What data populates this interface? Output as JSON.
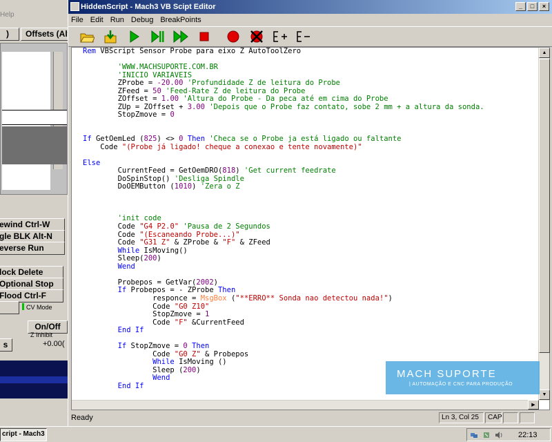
{
  "background_app": {
    "menu_fragment": "Help",
    "offsets_tab": "Offsets (Alt",
    "left_tab": ")",
    "rewind": "ewind Ctrl-W",
    "single_block": "gle BLK Alt-N",
    "reverse_run": "everse Run",
    "block_delete": "lock Delete",
    "optional_stop": "Optional Stop",
    "flood": "Flood Ctrl-F",
    "cv_mode": "CV Mode",
    "on_off": "On/Off",
    "z_inhibit": "Z Inhibit",
    "s_fragment": "s",
    "value": "+0.00("
  },
  "editor": {
    "title": "HiddenScript - Mach3 VB Scipt Editor",
    "menu": [
      "File",
      "Edit",
      "Run",
      "Debug",
      "BreakPoints"
    ],
    "toolbar_icons": [
      "open-folder-icon",
      "save-icon",
      "run-icon",
      "pause-icon",
      "step-icon",
      "stop-icon",
      "breakpoint-icon",
      "clear-breakpoint-icon",
      "watch-add-icon",
      "watch-remove-icon"
    ],
    "status": {
      "text": "Ready",
      "position": "Ln 3, Col 25",
      "caps": "CAP"
    },
    "watermark": {
      "title": "MACH SUPORTE",
      "subtitle": "| AUTOMAÇÃO E CNC PARA PRODUÇÃO"
    },
    "code_lines": [
      [
        [
          "k",
          "Rem"
        ],
        [
          "p",
          " VBScript Sensor Probe para eixo Z AutoToolZero"
        ]
      ],
      [
        [
          "p",
          ""
        ]
      ],
      [
        [
          "c",
          "        'WWW.MACHSUPORTE.COM.BR"
        ]
      ],
      [
        [
          "c",
          "        'INICIO VARIAVEIS"
        ]
      ],
      [
        [
          "p",
          "        ZProbe = "
        ],
        [
          "n",
          "-20.00"
        ],
        [
          "c",
          " 'Profundidade Z de leitura do Probe"
        ]
      ],
      [
        [
          "p",
          "        ZFeed = "
        ],
        [
          "n",
          "50"
        ],
        [
          "c",
          " 'Feed-Rate Z de leitura do Probe"
        ]
      ],
      [
        [
          "p",
          "        ZOffset = "
        ],
        [
          "n",
          "1.00"
        ],
        [
          "c",
          " 'Altura do Probe - Da peca até em cima do Probe"
        ]
      ],
      [
        [
          "p",
          "        ZUp = ZOffset + "
        ],
        [
          "n",
          "3.00"
        ],
        [
          "c",
          " 'Depois que o Probe faz contato, sobe 2 mm + a altura da sonda."
        ]
      ],
      [
        [
          "p",
          "        StopZmove = "
        ],
        [
          "n",
          "0"
        ]
      ],
      [
        [
          "p",
          ""
        ]
      ],
      [
        [
          "p",
          ""
        ]
      ],
      [
        [
          "k",
          "If"
        ],
        [
          "p",
          " GetOemLed ("
        ],
        [
          "n",
          "825"
        ],
        [
          "p",
          ") <> "
        ],
        [
          "n",
          "0"
        ],
        [
          "k",
          " Then"
        ],
        [
          "c",
          " 'Checa se o Probe ja está ligado ou faltante"
        ]
      ],
      [
        [
          "p",
          "    Code "
        ],
        [
          "s",
          "\"(Probe já ligado! cheque a conexao e tente novamente)\""
        ]
      ],
      [
        [
          "p",
          ""
        ]
      ],
      [
        [
          "k",
          "Else"
        ]
      ],
      [
        [
          "p",
          "        CurrentFeed = GetOemDRO("
        ],
        [
          "n",
          "818"
        ],
        [
          "p",
          ") "
        ],
        [
          "c",
          "'Get current feedrate"
        ]
      ],
      [
        [
          "p",
          "        DoSpinStop() "
        ],
        [
          "c",
          "'Desliga Spindle"
        ]
      ],
      [
        [
          "p",
          "        DoOEMButton ("
        ],
        [
          "n",
          "1010"
        ],
        [
          "p",
          ") "
        ],
        [
          "c",
          "'Zera o Z"
        ]
      ],
      [
        [
          "p",
          ""
        ]
      ],
      [
        [
          "p",
          ""
        ]
      ],
      [
        [
          "p",
          ""
        ]
      ],
      [
        [
          "c",
          "        'init code"
        ]
      ],
      [
        [
          "p",
          "        Code "
        ],
        [
          "s",
          "\"G4 P2.0\""
        ],
        [
          "c",
          " 'Pausa de 2 Segundos"
        ]
      ],
      [
        [
          "p",
          "        Code "
        ],
        [
          "s",
          "\"(Escaneando Probe...)\""
        ]
      ],
      [
        [
          "p",
          "        Code "
        ],
        [
          "s",
          "\"G31 Z\""
        ],
        [
          "p",
          " & ZProbe & "
        ],
        [
          "s",
          "\"F\""
        ],
        [
          "p",
          " & ZFeed"
        ]
      ],
      [
        [
          "k",
          "        While"
        ],
        [
          "p",
          " IsMoving()"
        ]
      ],
      [
        [
          "p",
          "        Sleep("
        ],
        [
          "n",
          "200"
        ],
        [
          "p",
          ")"
        ]
      ],
      [
        [
          "k",
          "        Wend"
        ]
      ],
      [
        [
          "p",
          ""
        ]
      ],
      [
        [
          "p",
          "        Probepos = GetVar("
        ],
        [
          "n",
          "2002"
        ],
        [
          "p",
          ")"
        ]
      ],
      [
        [
          "k",
          "        If"
        ],
        [
          "p",
          " Probepos = - ZProbe "
        ],
        [
          "k",
          "Then"
        ]
      ],
      [
        [
          "p",
          "                responce = "
        ],
        [
          "m",
          "MsgBox"
        ],
        [
          "p",
          " ("
        ],
        [
          "s",
          "\"**ERRO** Sonda nao detectou nada!\""
        ],
        [
          "p",
          ")"
        ]
      ],
      [
        [
          "p",
          "                Code "
        ],
        [
          "s",
          "\"G0 Z10\""
        ]
      ],
      [
        [
          "p",
          "                StopZmove = "
        ],
        [
          "n",
          "1"
        ]
      ],
      [
        [
          "p",
          "                Code "
        ],
        [
          "s",
          "\"F\""
        ],
        [
          "p",
          " &CurrentFeed"
        ]
      ],
      [
        [
          "k",
          "        End If"
        ]
      ],
      [
        [
          "p",
          ""
        ]
      ],
      [
        [
          "k",
          "        If"
        ],
        [
          "p",
          " StopZmove = "
        ],
        [
          "n",
          "0"
        ],
        [
          "k",
          " Then"
        ]
      ],
      [
        [
          "p",
          "                Code "
        ],
        [
          "s",
          "\"G0 Z\""
        ],
        [
          "p",
          " & Probepos"
        ]
      ],
      [
        [
          "k",
          "                While"
        ],
        [
          "p",
          " IsMoving ()"
        ]
      ],
      [
        [
          "p",
          "                Sleep ("
        ],
        [
          "n",
          "200"
        ],
        [
          "p",
          ")"
        ]
      ],
      [
        [
          "k",
          "                Wend"
        ]
      ],
      [
        [
          "k",
          "        End If"
        ]
      ]
    ]
  },
  "taskbar": {
    "task_label": "cript - Mach3 ...",
    "clock": "22:13"
  }
}
